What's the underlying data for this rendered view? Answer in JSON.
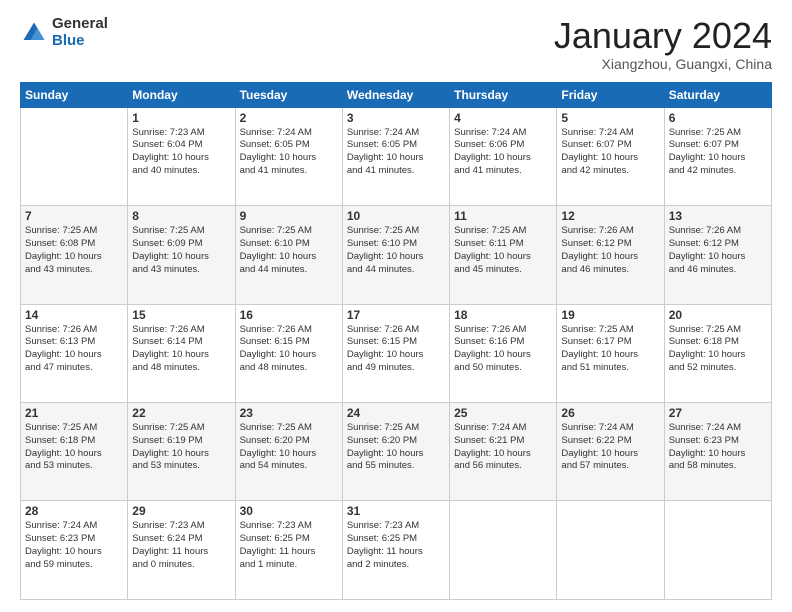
{
  "logo": {
    "general": "General",
    "blue": "Blue"
  },
  "title": "January 2024",
  "location": "Xiangzhou, Guangxi, China",
  "days_of_week": [
    "Sunday",
    "Monday",
    "Tuesday",
    "Wednesday",
    "Thursday",
    "Friday",
    "Saturday"
  ],
  "weeks": [
    [
      {
        "num": "",
        "info": ""
      },
      {
        "num": "1",
        "info": "Sunrise: 7:23 AM\nSunset: 6:04 PM\nDaylight: 10 hours\nand 40 minutes."
      },
      {
        "num": "2",
        "info": "Sunrise: 7:24 AM\nSunset: 6:05 PM\nDaylight: 10 hours\nand 41 minutes."
      },
      {
        "num": "3",
        "info": "Sunrise: 7:24 AM\nSunset: 6:05 PM\nDaylight: 10 hours\nand 41 minutes."
      },
      {
        "num": "4",
        "info": "Sunrise: 7:24 AM\nSunset: 6:06 PM\nDaylight: 10 hours\nand 41 minutes."
      },
      {
        "num": "5",
        "info": "Sunrise: 7:24 AM\nSunset: 6:07 PM\nDaylight: 10 hours\nand 42 minutes."
      },
      {
        "num": "6",
        "info": "Sunrise: 7:25 AM\nSunset: 6:07 PM\nDaylight: 10 hours\nand 42 minutes."
      }
    ],
    [
      {
        "num": "7",
        "info": "Sunrise: 7:25 AM\nSunset: 6:08 PM\nDaylight: 10 hours\nand 43 minutes."
      },
      {
        "num": "8",
        "info": "Sunrise: 7:25 AM\nSunset: 6:09 PM\nDaylight: 10 hours\nand 43 minutes."
      },
      {
        "num": "9",
        "info": "Sunrise: 7:25 AM\nSunset: 6:10 PM\nDaylight: 10 hours\nand 44 minutes."
      },
      {
        "num": "10",
        "info": "Sunrise: 7:25 AM\nSunset: 6:10 PM\nDaylight: 10 hours\nand 44 minutes."
      },
      {
        "num": "11",
        "info": "Sunrise: 7:25 AM\nSunset: 6:11 PM\nDaylight: 10 hours\nand 45 minutes."
      },
      {
        "num": "12",
        "info": "Sunrise: 7:26 AM\nSunset: 6:12 PM\nDaylight: 10 hours\nand 46 minutes."
      },
      {
        "num": "13",
        "info": "Sunrise: 7:26 AM\nSunset: 6:12 PM\nDaylight: 10 hours\nand 46 minutes."
      }
    ],
    [
      {
        "num": "14",
        "info": "Sunrise: 7:26 AM\nSunset: 6:13 PM\nDaylight: 10 hours\nand 47 minutes."
      },
      {
        "num": "15",
        "info": "Sunrise: 7:26 AM\nSunset: 6:14 PM\nDaylight: 10 hours\nand 48 minutes."
      },
      {
        "num": "16",
        "info": "Sunrise: 7:26 AM\nSunset: 6:15 PM\nDaylight: 10 hours\nand 48 minutes."
      },
      {
        "num": "17",
        "info": "Sunrise: 7:26 AM\nSunset: 6:15 PM\nDaylight: 10 hours\nand 49 minutes."
      },
      {
        "num": "18",
        "info": "Sunrise: 7:26 AM\nSunset: 6:16 PM\nDaylight: 10 hours\nand 50 minutes."
      },
      {
        "num": "19",
        "info": "Sunrise: 7:25 AM\nSunset: 6:17 PM\nDaylight: 10 hours\nand 51 minutes."
      },
      {
        "num": "20",
        "info": "Sunrise: 7:25 AM\nSunset: 6:18 PM\nDaylight: 10 hours\nand 52 minutes."
      }
    ],
    [
      {
        "num": "21",
        "info": "Sunrise: 7:25 AM\nSunset: 6:18 PM\nDaylight: 10 hours\nand 53 minutes."
      },
      {
        "num": "22",
        "info": "Sunrise: 7:25 AM\nSunset: 6:19 PM\nDaylight: 10 hours\nand 53 minutes."
      },
      {
        "num": "23",
        "info": "Sunrise: 7:25 AM\nSunset: 6:20 PM\nDaylight: 10 hours\nand 54 minutes."
      },
      {
        "num": "24",
        "info": "Sunrise: 7:25 AM\nSunset: 6:20 PM\nDaylight: 10 hours\nand 55 minutes."
      },
      {
        "num": "25",
        "info": "Sunrise: 7:24 AM\nSunset: 6:21 PM\nDaylight: 10 hours\nand 56 minutes."
      },
      {
        "num": "26",
        "info": "Sunrise: 7:24 AM\nSunset: 6:22 PM\nDaylight: 10 hours\nand 57 minutes."
      },
      {
        "num": "27",
        "info": "Sunrise: 7:24 AM\nSunset: 6:23 PM\nDaylight: 10 hours\nand 58 minutes."
      }
    ],
    [
      {
        "num": "28",
        "info": "Sunrise: 7:24 AM\nSunset: 6:23 PM\nDaylight: 10 hours\nand 59 minutes."
      },
      {
        "num": "29",
        "info": "Sunrise: 7:23 AM\nSunset: 6:24 PM\nDaylight: 11 hours\nand 0 minutes."
      },
      {
        "num": "30",
        "info": "Sunrise: 7:23 AM\nSunset: 6:25 PM\nDaylight: 11 hours\nand 1 minute."
      },
      {
        "num": "31",
        "info": "Sunrise: 7:23 AM\nSunset: 6:25 PM\nDaylight: 11 hours\nand 2 minutes."
      },
      {
        "num": "",
        "info": ""
      },
      {
        "num": "",
        "info": ""
      },
      {
        "num": "",
        "info": ""
      }
    ]
  ]
}
